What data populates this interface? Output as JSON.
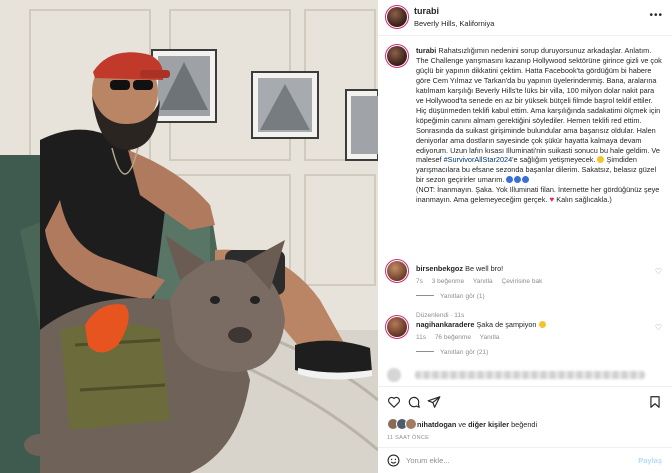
{
  "post": {
    "username": "turabi",
    "location": "Beverly Hills, Kaliforniya"
  },
  "caption": {
    "username": "turabi",
    "text_1": "Rahatsızlığımın nedenini sorup duruyorsunuz arkadaşlar. Anlatım. The Challenge yarışmasını kazanıp Hollywood sektörüne girince gizli ve çok güçlü bir yapının dikkatini çektim. Hatta Facebook'ta gördüğüm bi habere göre Cem Yılmaz ve Tarkan'da bu yapının üyelerindenmiş. Bana, aralarına katılmam karşılığı Beverly Hills'te lüks bir villa, 100 milyon dolar nakit para ve Hollywood'ta senede en az bir yüksek bütçeli filmde başrol teklif ettiler. Hiç düşünmeden teklifi kabul ettim. Ama karşılığında sadakatimi ölçmek için köpeğimin canını almam gerektiğini söylediler. Hemen teklifi red ettim. Sonrasında da suikast girişiminde bulundular ama başarısız oldular. Halen deniyorlar ama dostların sayesinde çok şükür hayatta kalmaya devam ediyorum. Uzun lafın kısası Illuminati'nin suikasti sonucu bu hale geldim. Ve malesef ",
    "hashtag": "#SurvivorAllStar2024",
    "text_2": "'e sağlığım yetişmeyecek. ",
    "text_3": " Şimdiden yarışmacılara bu efsane sezonda başarılar dilerim. Sakatsız, belasız güzel bir sezon geçirirler umarım. ",
    "text_4": "(NOT: İnanmayın. Şaka. Yok Illuminati filan. İnternette her gördüğünüz şeye inanmayın. Ama gelemeyeceğim gerçek. ",
    "text_5": " Kalın sağlıcakla.)",
    "edited": "Düzenlendi · 11s"
  },
  "comments": [
    {
      "username": "birsenbekgoz",
      "text": "Be well bro!",
      "time": "7s",
      "likes": "3 beğenme",
      "reply": "Yanıtla",
      "translate": "Çevirisine bak",
      "replies": "Yanıtları gör (1)"
    },
    {
      "username": "nagihankaradere",
      "text": "Şaka de şampiyon ",
      "time": "11s",
      "likes": "76 beğenme",
      "reply": "Yanıtla",
      "replies": "Yanıtları gör (21)"
    }
  ],
  "actions": {
    "liked_user": "nihatdogan",
    "liked_mid": " ve ",
    "liked_others": "diğer kişiler",
    "liked_end": " beğendi",
    "timestamp": "11 SAAT ÖNCE",
    "comment_placeholder": "Yorum ekle...",
    "post_label": "Paylaş"
  },
  "colors": {
    "link": "#00376b",
    "post_disabled": "#b3dbff",
    "story_ring": "#d62976",
    "cap": "#c0392b",
    "toy": "#e8541f",
    "harness": "#6b6b3a"
  }
}
